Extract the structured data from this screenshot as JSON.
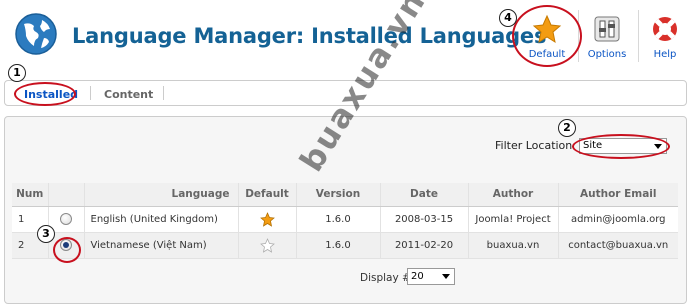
{
  "header": {
    "title": "Language Manager: Installed Languages",
    "toolbar": {
      "default_label": "Default",
      "options_label": "Options",
      "help_label": "Help"
    }
  },
  "submenu": {
    "items": [
      {
        "label": "Installed",
        "active": true
      },
      {
        "label": "Content",
        "active": false
      }
    ]
  },
  "filter": {
    "label": "Filter Location",
    "selected": "Site"
  },
  "table": {
    "columns": [
      "Num",
      "",
      "Language",
      "Default",
      "Version",
      "Date",
      "Author",
      "Author Email"
    ],
    "rows": [
      {
        "num": "1",
        "selected": false,
        "language": "English (United Kingdom)",
        "default": true,
        "version": "1.6.0",
        "date": "2008-03-15",
        "author": "Joomla! Project",
        "email": "admin@joomla.org"
      },
      {
        "num": "2",
        "selected": true,
        "language": "Vietnamese (Việt Nam)",
        "default": false,
        "version": "1.6.0",
        "date": "2011-02-20",
        "author": "buaxua.vn",
        "email": "contact@buaxua.vn"
      }
    ]
  },
  "pagination": {
    "display_label": "Display #",
    "display_value": "20"
  },
  "callouts": [
    "1",
    "2",
    "3",
    "4"
  ],
  "watermark": "buaxua.vn",
  "colors": {
    "title": "#146295",
    "link": "#0b55c4",
    "callout_ring": "#c8101e",
    "star": "#f39c12"
  }
}
